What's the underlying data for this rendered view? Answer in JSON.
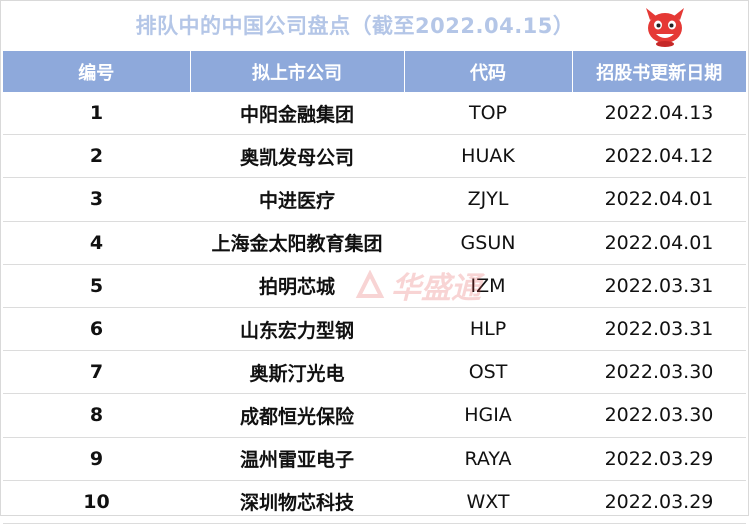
{
  "title": "排队中的中国公司盘点（截至2022.04.15）",
  "watermark_text": "华盛通",
  "colors": {
    "header_bg": "#8ea9db",
    "title": "#b4c6e7",
    "watermark": "#e04040"
  },
  "table": {
    "headers": [
      "编号",
      "拟上市公司",
      "代码",
      "招股书更新日期"
    ],
    "rows": [
      {
        "num": "1",
        "name": "中阳金融集团",
        "code": "TOP",
        "date": "2022.04.13"
      },
      {
        "num": "2",
        "name": "奥凯发母公司",
        "code": "HUAK",
        "date": "2022.04.12"
      },
      {
        "num": "3",
        "name": "中进医疗",
        "code": "ZJYL",
        "date": "2022.04.01"
      },
      {
        "num": "4",
        "name": "上海金太阳教育集团",
        "code": "GSUN",
        "date": "2022.04.01"
      },
      {
        "num": "5",
        "name": "拍明芯城",
        "code": "IZM",
        "date": "2022.03.31"
      },
      {
        "num": "6",
        "name": "山东宏力型钢",
        "code": "HLP",
        "date": "2022.03.31"
      },
      {
        "num": "7",
        "name": "奥斯汀光电",
        "code": "OST",
        "date": "2022.03.30"
      },
      {
        "num": "8",
        "name": "成都恒光保险",
        "code": "HGIA",
        "date": "2022.03.30"
      },
      {
        "num": "9",
        "name": "温州雷亚电子",
        "code": "RAYA",
        "date": "2022.03.29"
      },
      {
        "num": "10",
        "name": "深圳物芯科技",
        "code": "WXT",
        "date": "2022.03.29"
      }
    ]
  }
}
